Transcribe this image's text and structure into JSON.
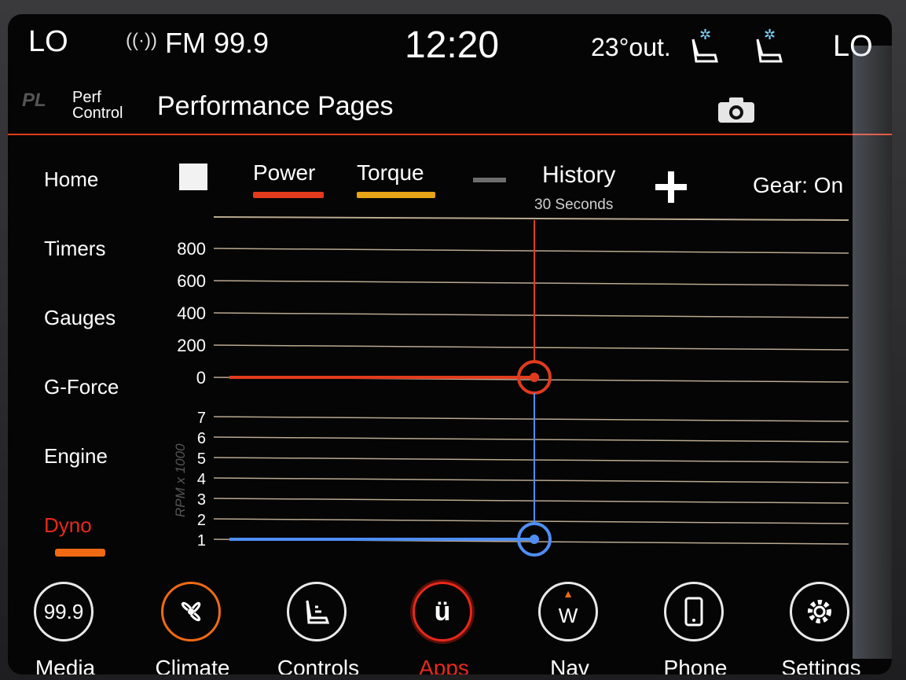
{
  "status_bar": {
    "left_climate": "LO",
    "right_climate": "LO",
    "radio_icon": "radio-signal-icon",
    "radio_station": "FM 99.9",
    "clock": "12:20",
    "outside_temp": "23°out."
  },
  "header": {
    "logo": "PL",
    "brand_line1": "Perf",
    "brand_line2": "Control",
    "title": "Performance Pages",
    "camera_icon": "camera-icon"
  },
  "sidebar": {
    "items": [
      {
        "label": "Home"
      },
      {
        "label": "Timers"
      },
      {
        "label": "Gauges"
      },
      {
        "label": "G-Force"
      },
      {
        "label": "Engine"
      },
      {
        "label": "Dyno",
        "active": true
      }
    ]
  },
  "chart_header": {
    "power_label": "Power",
    "torque_label": "Torque",
    "history_label": "History",
    "history_sub": "30 Seconds",
    "gear_status": "Gear: On"
  },
  "colors": {
    "accent_red": "#e8281a",
    "power": "#e23a1d",
    "torque": "#e8a317",
    "rpm": "#4f8ef5",
    "gridline": "#b9a98f"
  },
  "chart_data": [
    {
      "type": "line",
      "title": "",
      "series": [
        {
          "name": "Power",
          "values": [
            0,
            0
          ]
        }
      ],
      "y_ticks": [
        "800",
        "600",
        "400",
        "200",
        "0"
      ],
      "ylim": [
        0,
        800
      ],
      "cursor_value": 0
    },
    {
      "type": "line",
      "ylabel": "RPM x 1000",
      "series": [
        {
          "name": "RPM",
          "values": [
            1,
            1
          ]
        }
      ],
      "y_ticks": [
        "7",
        "6",
        "5",
        "4",
        "3",
        "2",
        "1"
      ],
      "ylim": [
        1,
        7
      ],
      "cursor_value": 1
    }
  ],
  "dock": {
    "items": [
      {
        "label": "Media",
        "icon_text": "99.9",
        "icon": "radio-icon"
      },
      {
        "label": "Climate",
        "icon": "fan-icon"
      },
      {
        "label": "Controls",
        "icon": "seat-controls-icon"
      },
      {
        "label": "Apps",
        "icon_text": "ü",
        "icon": "apps-icon",
        "active": true
      },
      {
        "label": "Nav",
        "icon_text": "W",
        "icon": "compass-icon"
      },
      {
        "label": "Phone",
        "icon": "phone-icon"
      },
      {
        "label": "Settings",
        "icon": "gear-icon"
      }
    ]
  }
}
